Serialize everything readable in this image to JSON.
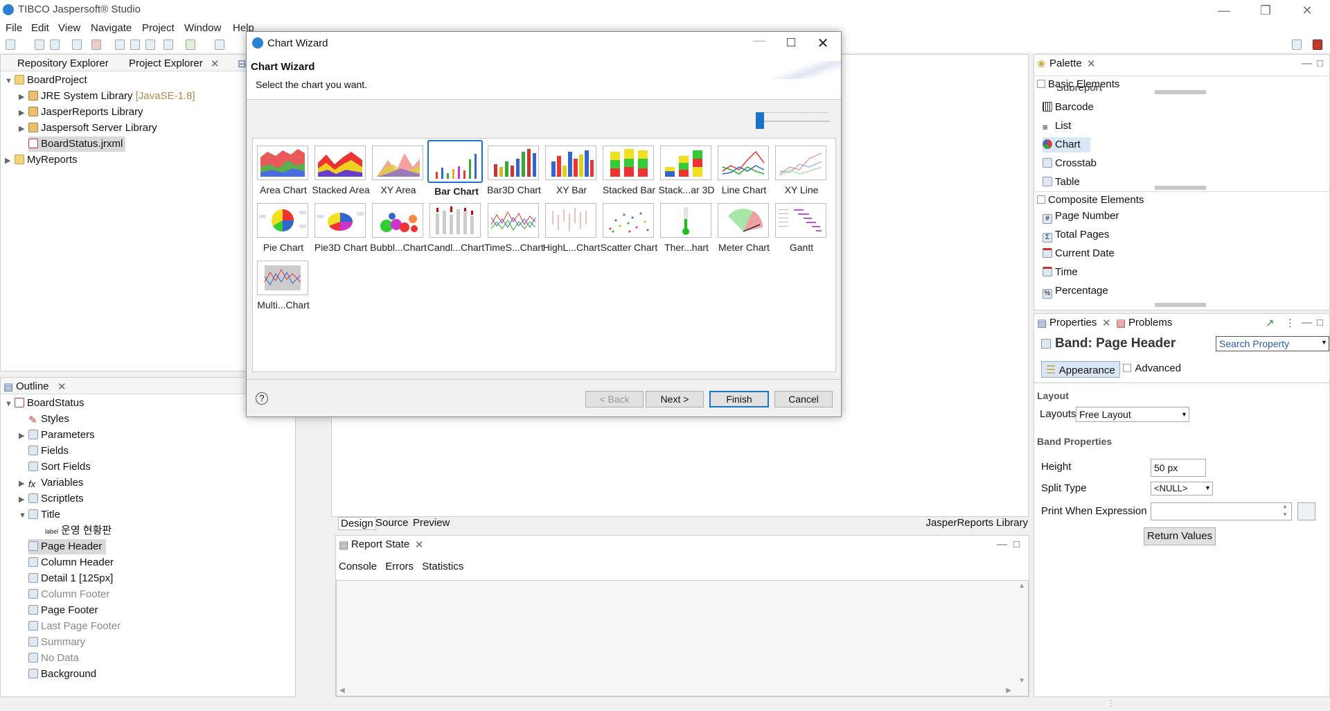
{
  "app": {
    "title": "TIBCO Jaspersoft® Studio"
  },
  "menu": [
    "File",
    "Edit",
    "View",
    "Navigate",
    "Project",
    "Window",
    "Help"
  ],
  "project_explorer": {
    "tabs": [
      "Repository Explorer",
      "Project Explorer"
    ],
    "tree": [
      {
        "label": "BoardProject"
      },
      {
        "label": "JRE System Library",
        "extra": "[JavaSE-1.8]"
      },
      {
        "label": "JasperReports Library"
      },
      {
        "label": "Jaspersoft Server Library"
      },
      {
        "label": "BoardStatus.jrxml"
      },
      {
        "label": "MyReports"
      }
    ]
  },
  "outline": {
    "tab": "Outline",
    "tree": [
      "BoardStatus",
      "Styles",
      "Parameters",
      "Fields",
      "Sort Fields",
      "Variables",
      "Scriptlets",
      "Title",
      "운영 현황판",
      "Page Header",
      "Column Header",
      "Detail 1 [125px]",
      "Column Footer",
      "Page Footer",
      "Last Page Footer",
      "Summary",
      "No Data",
      "Background"
    ],
    "label_prefix": "label"
  },
  "wizard": {
    "window_title": "Chart Wizard",
    "heading": "Chart Wizard",
    "subtitle": "Select the chart you want.",
    "charts": [
      "Area Chart",
      "Stacked Area",
      "XY Area",
      "Bar Chart",
      "Bar3D Chart",
      "XY Bar",
      "Stacked Bar",
      "Stack...ar 3D",
      "Line Chart",
      "XY Line",
      "Pie Chart",
      "Pie3D Chart",
      "Bubbl...Chart",
      "Candl...Chart",
      "TimeS...Chart",
      "HighL...Chart",
      "Scatter Chart",
      "Ther...hart",
      "Meter Chart",
      "Gantt",
      "Multi...Chart"
    ],
    "selected": "Bar Chart",
    "buttons": {
      "back": "< Back",
      "next": "Next >",
      "finish": "Finish",
      "cancel": "Cancel"
    },
    "help": "?"
  },
  "editor": {
    "tabs": [
      "Design",
      "Source",
      "Preview"
    ],
    "library": "JasperReports Library",
    "report_state_tab": "Report State",
    "subtabs": [
      "Console",
      "Errors",
      "Statistics"
    ]
  },
  "palette": {
    "tab": "Palette",
    "basic_header": "Basic Elements",
    "basic": [
      "Subreport",
      "Barcode",
      "List",
      "Chart",
      "Crosstab",
      "Table"
    ],
    "composite_header": "Composite Elements",
    "composite": [
      "Page Number",
      "Total Pages",
      "Current Date",
      "Time",
      "Percentage"
    ]
  },
  "properties": {
    "tabs": [
      "Properties",
      "Problems"
    ],
    "band_title": "Band: Page Header",
    "search_placeholder": "Search Property",
    "subtabs": [
      "Appearance",
      "Advanced"
    ],
    "layout_section": "Layout",
    "layouts_label": "Layouts",
    "layouts_value": "Free Layout",
    "band_section": "Band Properties",
    "height_label": "Height",
    "height_value": "50 px",
    "split_label": "Split Type",
    "split_value": "<NULL>",
    "print_label": "Print When Expression",
    "return_button": "Return Values"
  }
}
